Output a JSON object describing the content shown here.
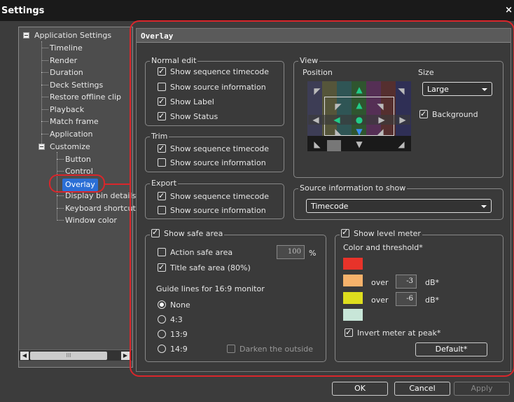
{
  "window": {
    "title": "Settings",
    "close": "×"
  },
  "tree": {
    "items": [
      {
        "label": "Application Settings"
      },
      {
        "label": "Timeline"
      },
      {
        "label": "Render"
      },
      {
        "label": "Duration"
      },
      {
        "label": "Deck Settings"
      },
      {
        "label": "Restore offline clip"
      },
      {
        "label": "Playback"
      },
      {
        "label": "Match frame"
      },
      {
        "label": "Application"
      },
      {
        "label": "Customize"
      },
      {
        "label": "Button"
      },
      {
        "label": "Control"
      },
      {
        "label": "Overlay"
      },
      {
        "label": "Display bin details"
      },
      {
        "label": "Keyboard shortcut"
      },
      {
        "label": "Window color"
      }
    ],
    "scroll_thumb": "III"
  },
  "panel": {
    "title": "Overlay",
    "normal_edit": {
      "title": "Normal edit",
      "items": [
        {
          "label": "Show sequence timecode",
          "checked": true
        },
        {
          "label": "Show source information",
          "checked": false
        },
        {
          "label": "Show Label",
          "checked": true
        },
        {
          "label": "Show Status",
          "checked": true
        }
      ]
    },
    "trim": {
      "title": "Trim",
      "items": [
        {
          "label": "Show sequence timecode",
          "checked": true
        },
        {
          "label": "Show source information",
          "checked": false
        }
      ]
    },
    "export": {
      "title": "Export",
      "items": [
        {
          "label": "Show sequence timecode",
          "checked": true
        },
        {
          "label": "Show source information",
          "checked": false
        }
      ]
    },
    "view": {
      "title": "View",
      "position_label": "Position",
      "size_label": "Size",
      "size_value": "Large",
      "background_label": "Background",
      "background_checked": true
    },
    "source_info": {
      "title": "Source information to show",
      "value": "Timecode"
    },
    "safe_area": {
      "title": "Show safe area",
      "checked": true,
      "action_label": "Action safe area",
      "action_checked": false,
      "action_value": "100",
      "action_unit": "%",
      "title_label": "Title safe area (80%)",
      "title_checked": true,
      "guide_label": "Guide lines for 16:9 monitor",
      "options": [
        {
          "label": "None",
          "selected": true
        },
        {
          "label": "4:3",
          "selected": false
        },
        {
          "label": "13:9",
          "selected": false
        },
        {
          "label": "14:9",
          "selected": false
        }
      ],
      "darken_label": "Darken the outside"
    },
    "level_meter": {
      "title": "Show level meter",
      "checked": true,
      "color_label": "Color and threshold*",
      "colors": [
        "#e8332a",
        "#f6b26b",
        "#dede1e",
        "#c8e6d8"
      ],
      "over_label": "over",
      "threshold1": "-3",
      "threshold2": "-6",
      "unit": "dB*",
      "invert_label": "Invert meter at peak*",
      "invert_checked": true,
      "default_button": "Default*"
    }
  },
  "footer": {
    "ok": "OK",
    "cancel": "Cancel",
    "apply": "Apply"
  },
  "accent": "#d9262b"
}
